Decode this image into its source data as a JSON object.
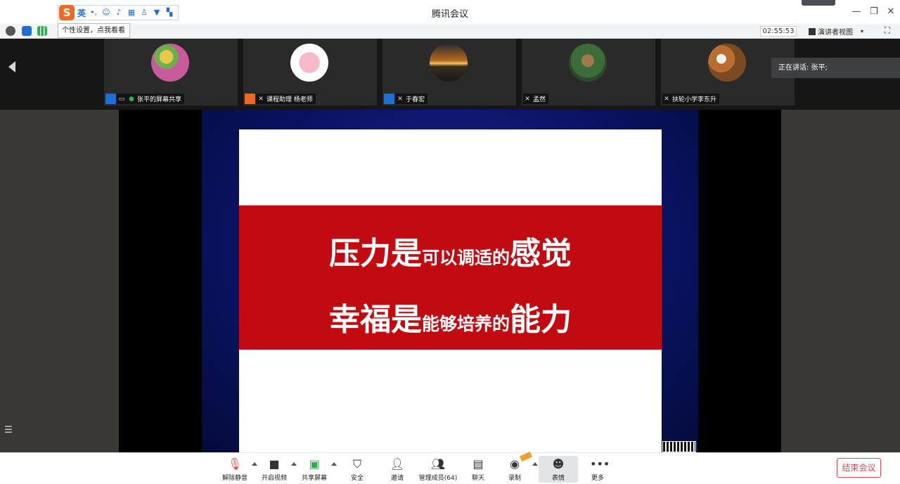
{
  "window": {
    "title": "腾讯会议"
  },
  "ime": {
    "logo": "S",
    "lang": "英"
  },
  "tooltip": {
    "text": "个性设置，点我看看"
  },
  "timer": {
    "text": "02:55:53"
  },
  "view_mode": {
    "label": "演讲者视图"
  },
  "participants": [
    {
      "name": "张平的屏幕共享",
      "role_color": "#1f6fd3"
    },
    {
      "name": "课程助理 杨老师",
      "role_color": "#ee6a22"
    },
    {
      "name": "于春宏",
      "role_color": "#1f6fd3"
    },
    {
      "name": "孟然",
      "role_color": ""
    },
    {
      "name": "扶轮小学李东升",
      "role_color": ""
    }
  ],
  "speaking": {
    "text": "正在讲话: 张平;"
  },
  "slide": {
    "line1": {
      "a": "压力是",
      "b": "可以调适的",
      "c": "感觉"
    },
    "line2": {
      "a": "幸福是",
      "b": "能够培养的",
      "c": "能力"
    },
    "band_color": "#c20b10"
  },
  "toolbar": {
    "items": [
      {
        "label": "解除静音",
        "icon": "mic-muted-icon"
      },
      {
        "label": "开启视频",
        "icon": "video-off-icon"
      },
      {
        "label": "共享屏幕",
        "icon": "share-screen-icon"
      },
      {
        "label": "安全",
        "icon": "shield-icon"
      },
      {
        "label": "邀请",
        "icon": "invite-icon"
      },
      {
        "label": "管理成员(64)",
        "icon": "members-icon"
      },
      {
        "label": "聊天",
        "icon": "chat-icon"
      },
      {
        "label": "录制",
        "icon": "record-icon"
      },
      {
        "label": "表情",
        "icon": "emoji-icon"
      },
      {
        "label": "更多",
        "icon": "more-icon"
      }
    ],
    "end_label": "结束会议"
  }
}
